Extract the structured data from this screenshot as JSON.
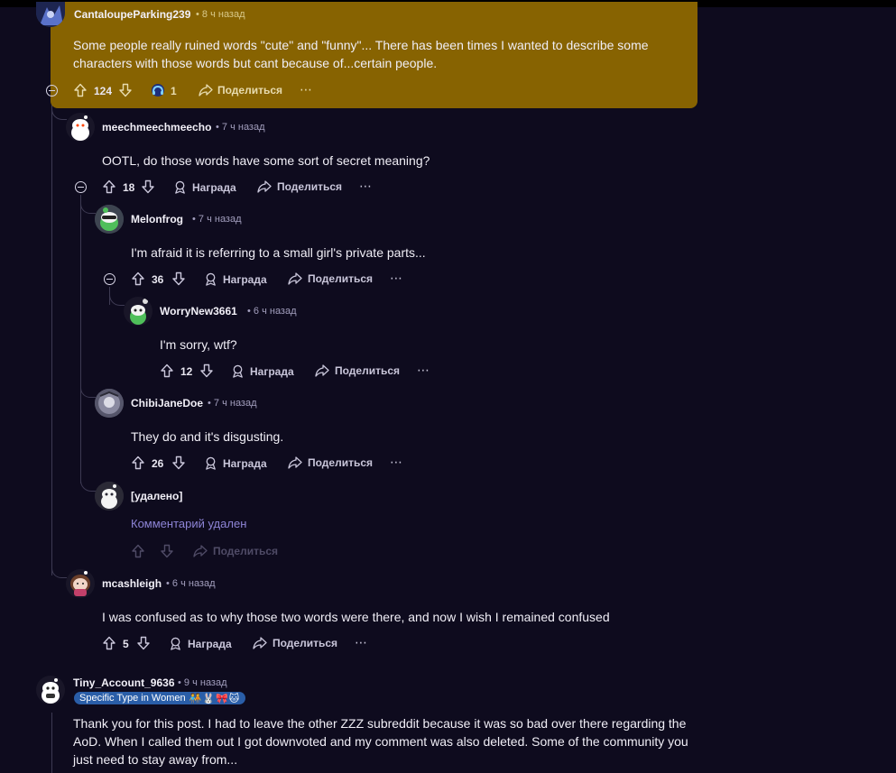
{
  "comments": [
    {
      "user": "CantaloupePark‍ing239",
      "time": "• 8 ч назад",
      "text": "Some people really ruined words \"cute\" and \"funny\"... There has been times I wanted to describe some characters with those words but cant because of...certain people.",
      "votes": "124",
      "awards": "1",
      "share": "Поделиться"
    },
    {
      "user": "meechmeechmeecho",
      "time": "• 7 ч назад",
      "text": "OOTL, do those words have some sort of secret meaning?",
      "votes": "18",
      "award": "Награда",
      "share": "Поделиться"
    },
    {
      "user": "Melonfrog",
      "time": "• 7 ч назад",
      "text": "I'm afraid it is referring to a small girl's private parts...",
      "votes": "36",
      "award": "Награда",
      "share": "Поделиться"
    },
    {
      "user": "WorryNew3661",
      "time": "• 6 ч назад",
      "text": "I'm sorry, wtf?",
      "votes": "12",
      "award": "Награда",
      "share": "Поделиться"
    },
    {
      "user": "ChibiJaneDoe",
      "time": "• 7 ч назад",
      "text": "They do and it's disgusting.",
      "votes": "26",
      "award": "Награда",
      "share": "Поделиться"
    },
    {
      "user": "[удалено]",
      "text": "Комментарий удален",
      "share": "Поделиться"
    },
    {
      "user": "mcashleigh",
      "time": "• 6 ч назад",
      "text": "I was confused as to why those two words were there, and now I wish I remained confused",
      "votes": "5",
      "award": "Награда",
      "share": "Поделиться"
    },
    {
      "user": "Tiny_Account_9636",
      "time": "• 9 ч назад",
      "flair": "Specific Type in Women",
      "flair_emoji": "🧑‍🤝‍🧑🐰🎀🐱",
      "text": "Thank you for this post. I had to leave the other ZZZ subreddit because it was so bad over there regarding the AoD. When I called them out I got downvoted and my comment was also deleted. Some of the community you just need to stay away from..."
    }
  ],
  "icons": {
    "more": "⋯"
  },
  "colors": {
    "background": "#0e0b1e",
    "highlight": "#876301",
    "flair": "#2a5ea8",
    "deleted_text": "#8d84d6"
  }
}
